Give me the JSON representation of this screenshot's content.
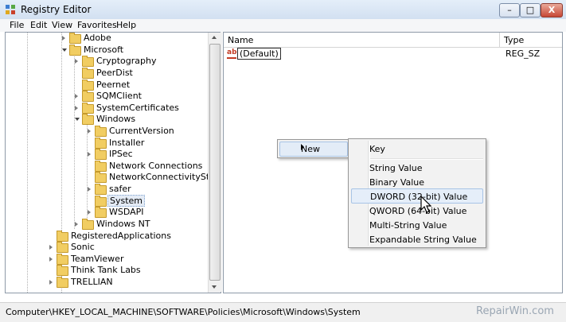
{
  "window": {
    "title": "Registry Editor",
    "minimize": "–",
    "maximize": "□",
    "close": "X"
  },
  "menu": [
    "File",
    "Edit",
    "View",
    "Favorites",
    "Help"
  ],
  "tree": [
    {
      "label": "Adobe"
    },
    {
      "label": "Microsoft"
    },
    {
      "label": "Cryptography"
    },
    {
      "label": "PeerDist"
    },
    {
      "label": "Peernet"
    },
    {
      "label": "SQMClient"
    },
    {
      "label": "SystemCertificates"
    },
    {
      "label": "Windows"
    },
    {
      "label": "CurrentVersion"
    },
    {
      "label": "Installer"
    },
    {
      "label": "IPSec"
    },
    {
      "label": "Network Connections"
    },
    {
      "label": "NetworkConnectivityStatusIn"
    },
    {
      "label": "safer"
    },
    {
      "label": "System"
    },
    {
      "label": "WSDAPI"
    },
    {
      "label": "Windows NT"
    },
    {
      "label": "RegisteredApplications"
    },
    {
      "label": "Sonic"
    },
    {
      "label": "TeamViewer"
    },
    {
      "label": "Think Tank Labs"
    },
    {
      "label": "TRELLIAN"
    }
  ],
  "list": {
    "columns": {
      "name": "Name",
      "type": "Type"
    },
    "rows": [
      {
        "name": "(Default)",
        "type": "REG_SZ",
        "icon": "ab-string-icon"
      }
    ]
  },
  "context_menu": {
    "new_label": "New"
  },
  "submenu": {
    "items": [
      "Key",
      "String Value",
      "Binary Value",
      "DWORD (32-bit) Value",
      "QWORD (64-bit) Value",
      "Multi-String Value",
      "Expandable String Value"
    ],
    "highlighted": "DWORD (32-bit) Value"
  },
  "status": {
    "path": "Computer\\HKEY_LOCAL_MACHINE\\SOFTWARE\\Policies\\Microsoft\\Windows\\System"
  },
  "watermark": "RepairWin.com",
  "colors": {
    "folder": "#f1cd62",
    "selection": "#e4ebf5",
    "menu_highlight": "#e5eef9"
  }
}
